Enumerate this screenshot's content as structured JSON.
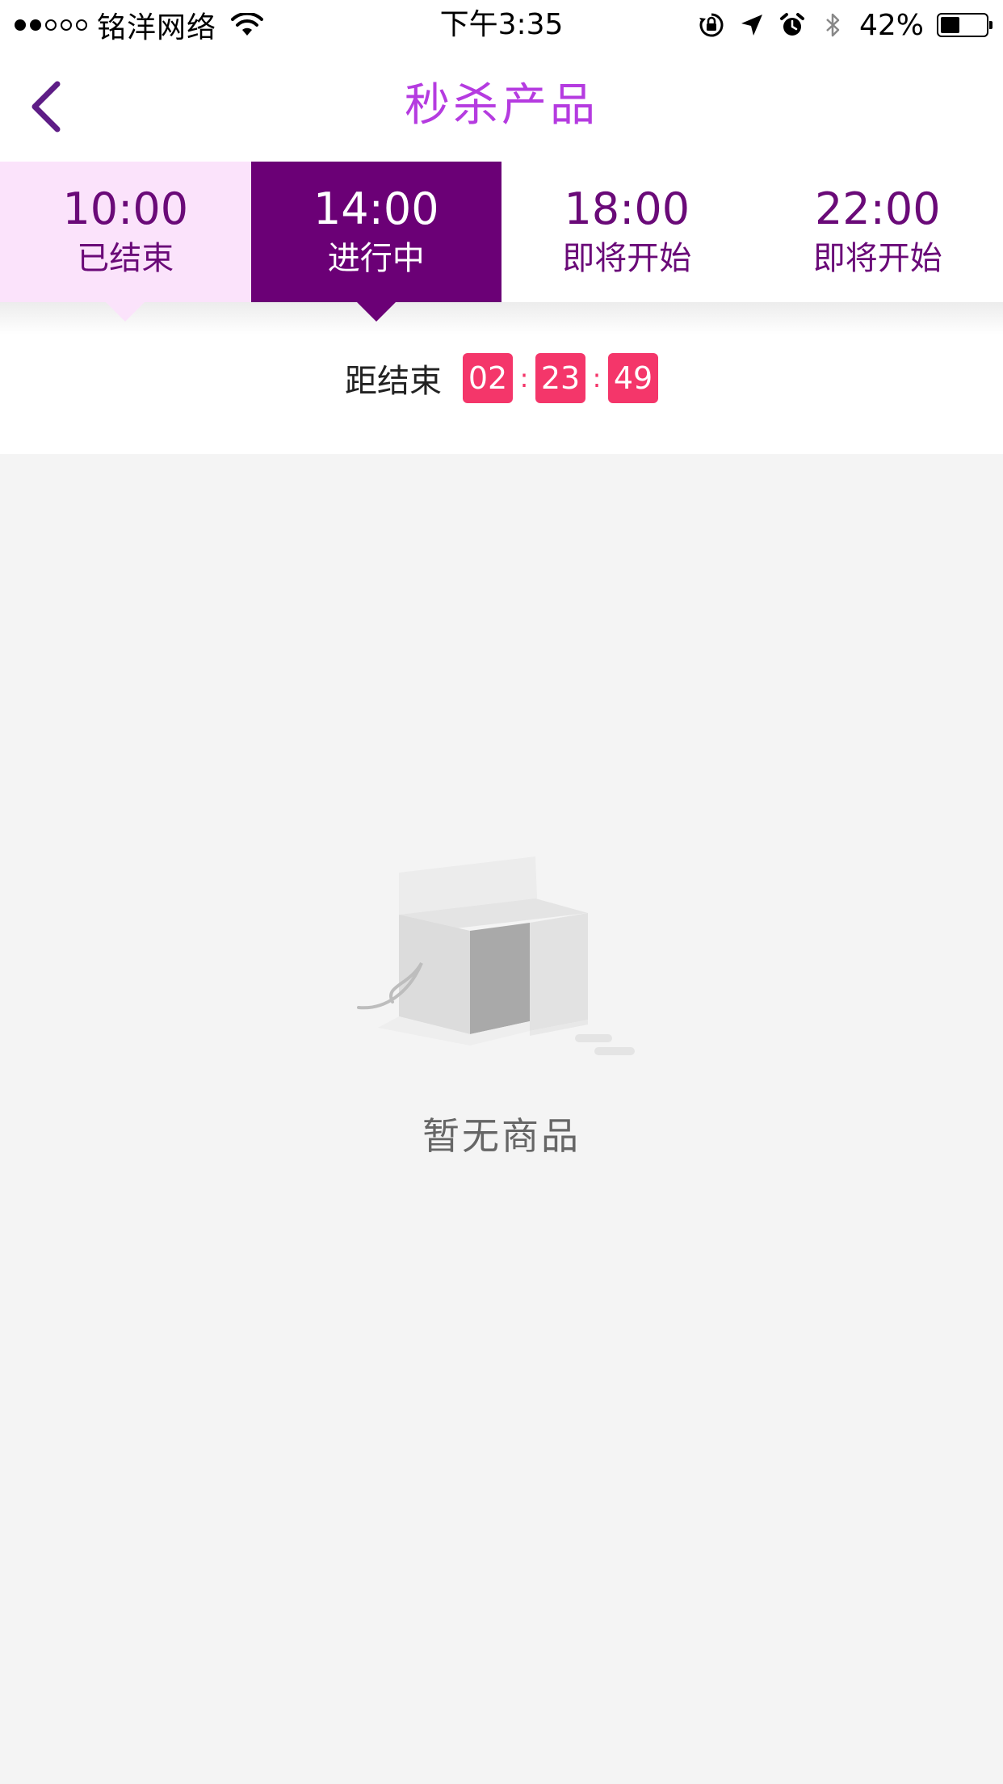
{
  "status_bar": {
    "carrier": "铭洋网络",
    "signal_full": 2,
    "signal_total": 5,
    "time": "下午3:35",
    "battery_percent": "42%",
    "battery_level": 0.42,
    "icons": [
      "wifi-icon",
      "orientation-lock-icon",
      "location-arrow-icon",
      "alarm-icon",
      "bluetooth-icon",
      "battery-icon"
    ]
  },
  "nav": {
    "title": "秒杀产品",
    "back_icon": "chevron-left-icon"
  },
  "tabs": [
    {
      "time": "10:00",
      "status": "已结束",
      "state": "ended"
    },
    {
      "time": "14:00",
      "status": "进行中",
      "state": "active"
    },
    {
      "time": "18:00",
      "status": "即将开始",
      "state": "upcoming"
    },
    {
      "time": "22:00",
      "status": "即将开始",
      "state": "upcoming"
    }
  ],
  "countdown": {
    "label": "距结束",
    "hours": "02",
    "minutes": "23",
    "seconds": "49",
    "separator": ":"
  },
  "empty_state": {
    "illustration": "empty-box-icon",
    "message": "暂无商品"
  },
  "colors": {
    "accent_title": "#b53be0",
    "tab_active_bg": "#6b0076",
    "tab_ended_bg": "#fbe3fb",
    "tab_text": "#6a0a78",
    "countdown_bg": "#f4366a",
    "page_bg": "#f4f4f4"
  }
}
